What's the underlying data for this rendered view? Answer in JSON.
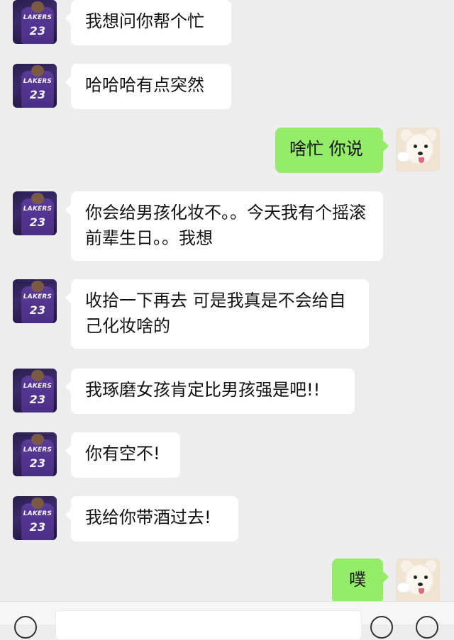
{
  "chat": {
    "messages": [
      {
        "side": "left",
        "text": "我想问你帮个忙"
      },
      {
        "side": "left",
        "text": "哈哈哈有点突然"
      },
      {
        "side": "right",
        "text": "啥忙 你说"
      },
      {
        "side": "left",
        "text": "你会给男孩化妆不。。今天我有个摇滚前辈生日。。我想"
      },
      {
        "side": "left",
        "text": "收拾一下再去 可是我真是不会给自己化妆啥的"
      },
      {
        "side": "left",
        "text": "我琢磨女孩肯定比男孩强是吧!!"
      },
      {
        "side": "left",
        "text": "你有空不!"
      },
      {
        "side": "left",
        "text": "我给你带酒过去!"
      },
      {
        "side": "right",
        "text": "噗"
      }
    ]
  },
  "avatars": {
    "left": {
      "team_text": "LAKERS",
      "number": "23",
      "icon": "lakers-jersey-avatar-icon"
    },
    "right": {
      "icon": "puppy-avatar-icon"
    }
  },
  "colors": {
    "background": "#ededed",
    "left_bubble": "#ffffff",
    "right_bubble": "#95ec69"
  }
}
